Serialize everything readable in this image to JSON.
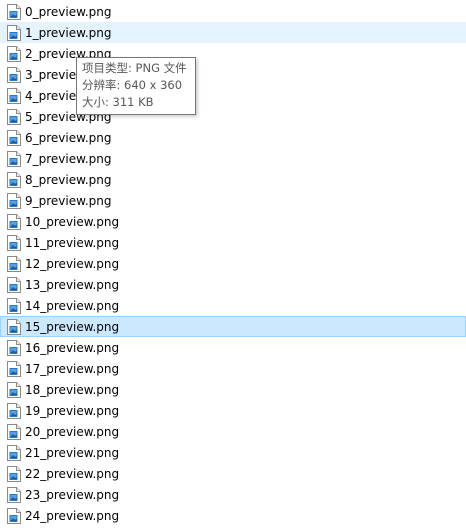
{
  "files": [
    {
      "name": "0_preview.png",
      "state": "normal"
    },
    {
      "name": "1_preview.png",
      "state": "hover"
    },
    {
      "name": "2_preview.png",
      "state": "normal"
    },
    {
      "name": "3_preview.png",
      "state": "normal"
    },
    {
      "name": "4_preview.png",
      "state": "normal"
    },
    {
      "name": "5_preview.png",
      "state": "normal"
    },
    {
      "name": "6_preview.png",
      "state": "normal"
    },
    {
      "name": "7_preview.png",
      "state": "normal"
    },
    {
      "name": "8_preview.png",
      "state": "normal"
    },
    {
      "name": "9_preview.png",
      "state": "normal"
    },
    {
      "name": "10_preview.png",
      "state": "normal"
    },
    {
      "name": "11_preview.png",
      "state": "normal"
    },
    {
      "name": "12_preview.png",
      "state": "normal"
    },
    {
      "name": "13_preview.png",
      "state": "normal"
    },
    {
      "name": "14_preview.png",
      "state": "normal"
    },
    {
      "name": "15_preview.png",
      "state": "selected"
    },
    {
      "name": "16_preview.png",
      "state": "normal"
    },
    {
      "name": "17_preview.png",
      "state": "normal"
    },
    {
      "name": "18_preview.png",
      "state": "normal"
    },
    {
      "name": "19_preview.png",
      "state": "normal"
    },
    {
      "name": "20_preview.png",
      "state": "normal"
    },
    {
      "name": "21_preview.png",
      "state": "normal"
    },
    {
      "name": "22_preview.png",
      "state": "normal"
    },
    {
      "name": "23_preview.png",
      "state": "normal"
    },
    {
      "name": "24_preview.png",
      "state": "normal"
    }
  ],
  "file_icon": "png-file-icon",
  "tooltip": {
    "type_line": "项目类型: PNG 文件",
    "dimensions_line": "分辨率: 640 x 360",
    "size_line": "大小: 311 KB"
  },
  "colors": {
    "hover_bg": "#e5f3ff",
    "selected_bg": "#cce8ff",
    "selected_border": "#99d1ff",
    "tooltip_border": "#767676",
    "tooltip_text": "#575757"
  }
}
